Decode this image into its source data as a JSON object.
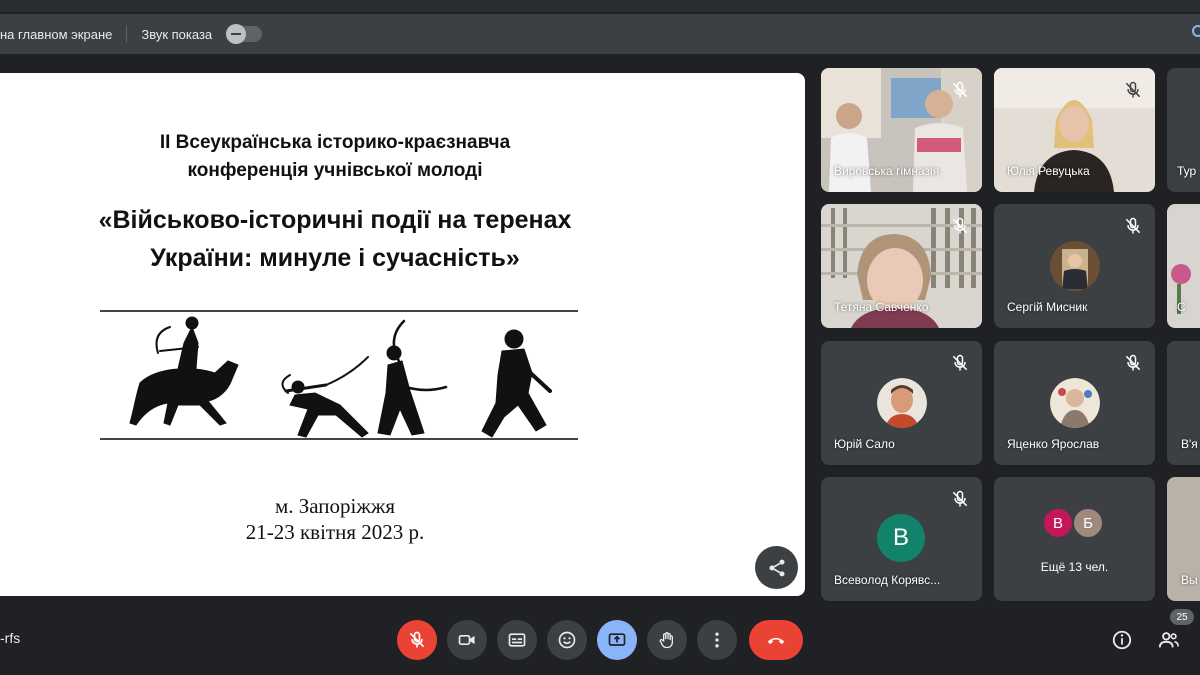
{
  "present_bar": {
    "main_screen_label": "на главном экране",
    "sound_label": "Звук показа"
  },
  "slide": {
    "subtitle_line1": "II Всеукраїнська історико-краєзнавча",
    "subtitle_line2": "конференція учнівської молоді",
    "title_line1": "«Військово-історичні події на теренах",
    "title_line2": "України: минуле і сучасність»",
    "city": "м. Запоріжжя",
    "dates": "21-23 квітня 2023 р."
  },
  "participants": [
    {
      "name": "Вировська гімназія"
    },
    {
      "name": "Юлія Ревуцька"
    },
    {
      "name": "Тур"
    },
    {
      "name": "Тетяна Савченко"
    },
    {
      "name": "Сергій Мисник"
    },
    {
      "name": "С"
    },
    {
      "name": "Юрій Сало"
    },
    {
      "name": "Яценко Ярослав"
    },
    {
      "name": "В'я"
    },
    {
      "name": "Всеволод Корявс...",
      "initial": "В"
    },
    {
      "name": "Вы"
    }
  ],
  "more_tile": {
    "avatar1": "В",
    "avatar2": "Б",
    "label": "Ещё 13 чел.",
    "avatar1_color": "#c2185b",
    "avatar2_color": "#a1887f"
  },
  "bottom_bar": {
    "meeting_code": "-rfs",
    "participants_count": "25"
  },
  "colors": {
    "background": "#202124",
    "tile": "#3c4043",
    "danger": "#ea4335",
    "active": "#8ab4f8"
  },
  "icons": {
    "mic_off": "mic-off-icon",
    "camera": "camera-icon",
    "captions": "captions-icon",
    "emoji": "emoji-icon",
    "present": "present-screen-icon",
    "hand": "raise-hand-icon",
    "more": "more-options-icon",
    "hangup": "hang-up-icon",
    "info": "info-icon",
    "people": "people-icon",
    "share": "share-icon"
  }
}
